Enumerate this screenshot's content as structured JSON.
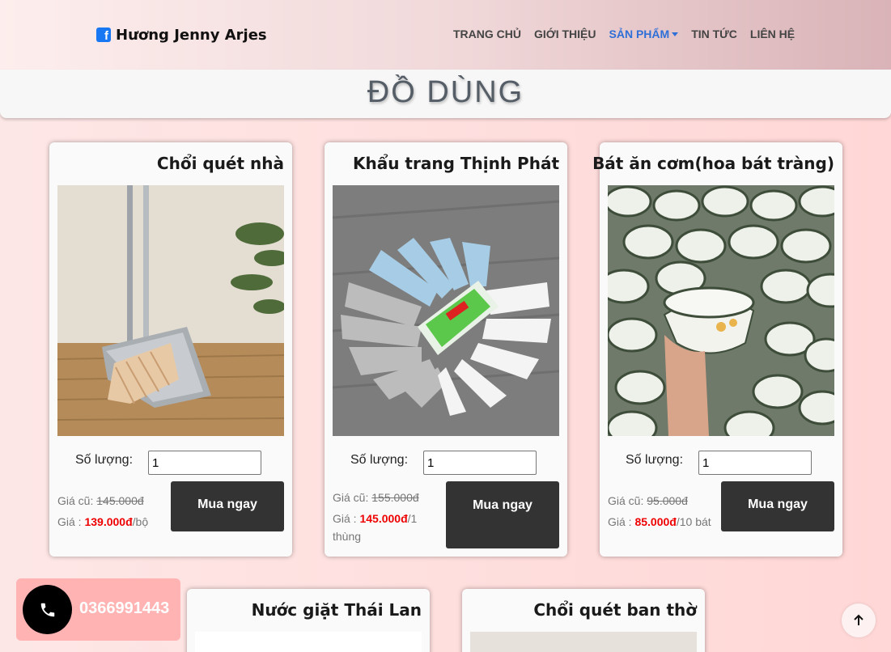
{
  "header": {
    "brand": "Hương Jenny Arjes",
    "brand_icon": "facebook-icon",
    "nav": [
      "TRANG CHỦ",
      "GIỚI THIỆU",
      "SẢN PHẨM",
      "TIN TỨC",
      "LIÊN HỆ"
    ],
    "active_nav": "SẢN PHẨM",
    "active_color": "#2f6fd8"
  },
  "page_title": "ĐỒ DÙNG",
  "labels": {
    "quantity": "Số lượng:",
    "old_price": "Giá cũ:",
    "price": "Giá :",
    "buy": "Mua ngay"
  },
  "products": [
    {
      "name": "Chổi quét nhà",
      "quantity": "1",
      "old_price": "145.000đ",
      "price": "139.000đ",
      "unit": "/bộ"
    },
    {
      "name": "Khẩu trang Thịnh Phát",
      "quantity": "1",
      "old_price": "155.000đ",
      "price": "145.000đ",
      "unit": "/1 thùng"
    },
    {
      "name": "Bát ăn cơm(hoa bát tràng)",
      "quantity": "1",
      "old_price": "95.000đ",
      "price": "85.000đ",
      "unit": "/10 bát"
    },
    {
      "name": "Nước giặt Thái Lan"
    },
    {
      "name": "Chổi quét ban thờ"
    }
  ],
  "phone": "0366991443",
  "colors": {
    "price_red": "#ee0000",
    "button": "#333333",
    "phone_bg": "#ffb3b3"
  }
}
